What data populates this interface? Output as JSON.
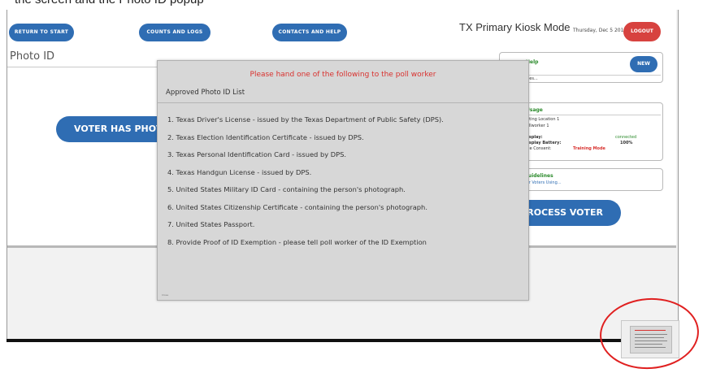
{
  "caption": "the screen and the Photo ID popup",
  "topbar": {
    "return_label": "RETURN TO START",
    "counts_label": "COUNTS AND LOGS",
    "contacts_label": "CONTACTS AND HELP",
    "kiosk_title": "TX Primary Kiosk Mode",
    "date": "Thursday, Dec 5 2019",
    "logout_label": "LOGOUT"
  },
  "main": {
    "page_title": "Photo ID",
    "voter_has_photo_label": "VOTER HAS PHOTO ID",
    "process_voter_label": "PROCESS VOTER"
  },
  "sidebar": {
    "help": {
      "title": "Help",
      "new_label": "NEW",
      "line": "ages..."
    },
    "usage": {
      "title": "Usage",
      "lines": [
        "Voting Location 1",
        "Pollworker 1"
      ],
      "display_label": "Display:",
      "display_value": "connected",
      "battery_label": "Display Battery:",
      "battery_value": "100%",
      "mode_label": "Age Consent:",
      "mode_value": "Training Mode"
    },
    "guidelines": {
      "title": "Guidelines",
      "line": "For Voters Using..."
    }
  },
  "modal": {
    "header": "Please hand one of the following to the poll worker",
    "subtitle": "Approved Photo ID List",
    "items": [
      "1. Texas Driver's License - issued by the Texas Department of Public Safety (DPS).",
      "2. Texas Election Identification Certificate - issued by DPS.",
      "3. Texas Personal Identification Card - issued by DPS.",
      "4. Texas Handgun License - issued by DPS.",
      "5. United States Military ID Card - containing the person's photograph.",
      "6. United States Citizenship Certificate - containing the person's photograph.",
      "7. United States Passport.",
      "8. Provide Proof of ID Exemption - please tell poll worker of the ID Exemption"
    ],
    "footer": "Close"
  },
  "colors": {
    "primary_blue": "#2f6db3",
    "logout_red": "#d7423f",
    "modal_header_red": "#d8322f",
    "annotation_red": "#e02020"
  }
}
